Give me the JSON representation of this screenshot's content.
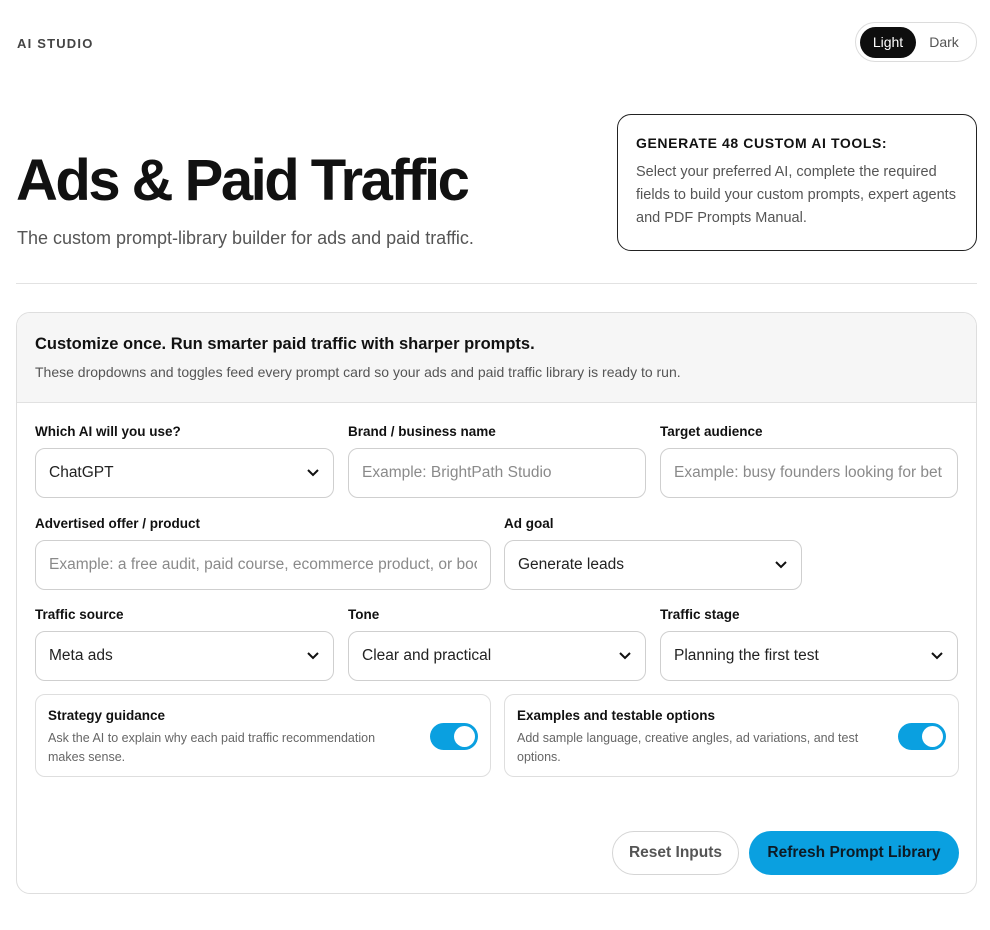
{
  "app": {
    "brand": "AI STUDIO"
  },
  "theme": {
    "light_label": "Light",
    "dark_label": "Dark",
    "selected": "Light"
  },
  "hero": {
    "title": "Ads & Paid Traffic",
    "subtitle": "The custom prompt-library builder for ads and paid traffic."
  },
  "promo": {
    "title": "GENERATE 48 CUSTOM AI TOOLS:",
    "text": "Select your preferred AI, complete the required fields to build your custom prompts, expert agents and PDF Prompts Manual."
  },
  "card": {
    "heading": "Customize once. Run smarter paid traffic with sharper prompts.",
    "description": "These dropdowns and toggles feed every prompt card so your ads and paid traffic library is ready to run."
  },
  "fields": {
    "ai": {
      "label": "Which AI will you use?",
      "value": "ChatGPT"
    },
    "brand": {
      "label": "Brand / business name",
      "placeholder": "Example: BrightPath Studio"
    },
    "audience": {
      "label": "Target audience",
      "placeholder": "Example: busy founders looking for bet"
    },
    "offer": {
      "label": "Advertised offer / product",
      "placeholder": "Example: a free audit, paid course, ecommerce product, or boo"
    },
    "goal": {
      "label": "Ad goal",
      "value": "Generate leads"
    },
    "source": {
      "label": "Traffic source",
      "value": "Meta ads"
    },
    "tone": {
      "label": "Tone",
      "value": "Clear and practical"
    },
    "stage": {
      "label": "Traffic stage",
      "value": "Planning the first test"
    }
  },
  "toggles": {
    "strategy": {
      "title": "Strategy guidance",
      "description": "Ask the AI to explain why each paid traffic recommendation makes sense.",
      "on": true
    },
    "examples": {
      "title": "Examples and testable options",
      "description": "Add sample language, creative angles, ad variations, and test options.",
      "on": true
    }
  },
  "actions": {
    "reset": "Reset Inputs",
    "refresh": "Refresh Prompt Library"
  },
  "colors": {
    "accent": "#0aa0e0",
    "dark": "#0e0e0e"
  },
  "icons": {
    "select_arrow": "chevron-down-icon"
  }
}
